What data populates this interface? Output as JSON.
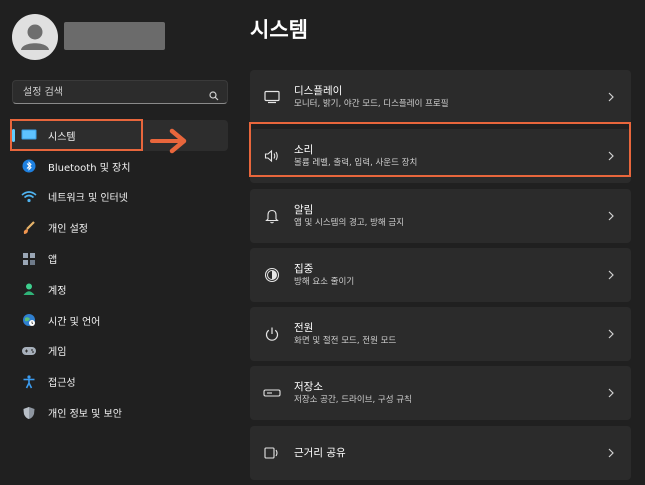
{
  "search": {
    "placeholder": "설정 검색"
  },
  "sidebar": {
    "items": [
      {
        "label": "시스템",
        "icon": "system-icon"
      },
      {
        "label": "Bluetooth 및 장치",
        "icon": "bluetooth-icon"
      },
      {
        "label": "네트워크 및 인터넷",
        "icon": "network-icon"
      },
      {
        "label": "개인 설정",
        "icon": "brush-icon"
      },
      {
        "label": "앱",
        "icon": "apps-icon"
      },
      {
        "label": "계정",
        "icon": "account-icon"
      },
      {
        "label": "시간 및 언어",
        "icon": "globe-clock-icon"
      },
      {
        "label": "게임",
        "icon": "gamepad-icon"
      },
      {
        "label": "접근성",
        "icon": "accessibility-icon"
      },
      {
        "label": "개인 정보 및 보안",
        "icon": "shield-icon"
      }
    ]
  },
  "main": {
    "title": "시스템",
    "cards": [
      {
        "title": "디스플레이",
        "subtitle": "모니터, 밝기, 야간 모드, 디스플레이 프로필",
        "icon": "display-icon"
      },
      {
        "title": "소리",
        "subtitle": "볼륨 레벨, 출력, 입력, 사운드 장치",
        "icon": "speaker-icon"
      },
      {
        "title": "알림",
        "subtitle": "앱 및 시스템의 경고, 방해 금지",
        "icon": "bell-icon"
      },
      {
        "title": "집중",
        "subtitle": "방해 요소 줄이기",
        "icon": "focus-icon"
      },
      {
        "title": "전원",
        "subtitle": "화면 및 절전 모드, 전원 모드",
        "icon": "power-icon"
      },
      {
        "title": "저장소",
        "subtitle": "저장소 공간, 드라이브, 구성 규칙",
        "icon": "storage-icon"
      },
      {
        "title": "근거리 공유",
        "subtitle": "",
        "icon": "nearby-share-icon"
      }
    ]
  },
  "colors": {
    "accent": "#60cdff",
    "highlight": "#e8663c",
    "background": "#202020",
    "card": "#2b2b2b"
  }
}
